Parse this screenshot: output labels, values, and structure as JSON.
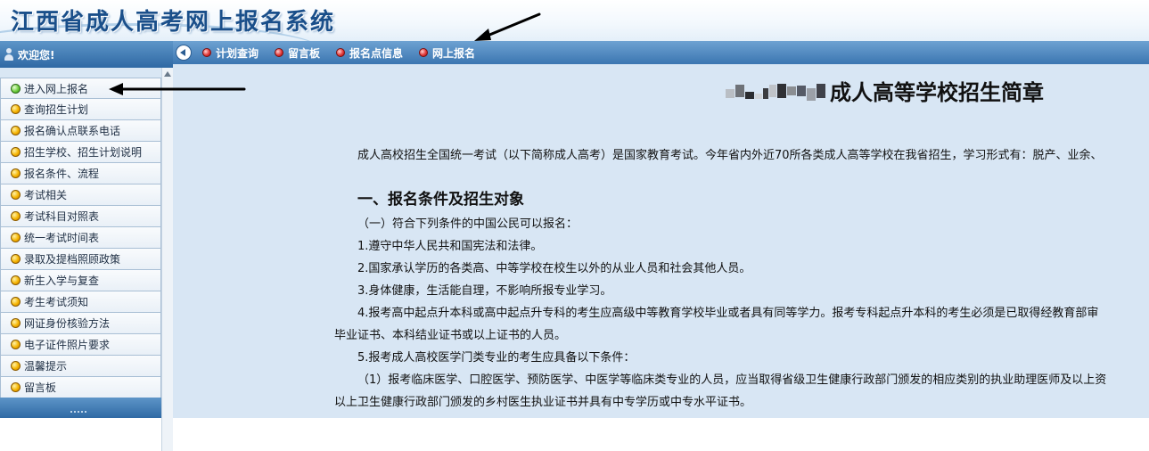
{
  "banner": {
    "title": "江西省成人高考网上报名系统"
  },
  "sidebar": {
    "welcome": "欢迎您!",
    "items": [
      {
        "label": "进入网上报名",
        "active": true
      },
      {
        "label": "查询招生计划"
      },
      {
        "label": "报名确认点联系电话"
      },
      {
        "label": "招生学校、招生计划说明"
      },
      {
        "label": "报名条件、流程"
      },
      {
        "label": "考试相关"
      },
      {
        "label": "考试科目对照表"
      },
      {
        "label": "统一考试时间表"
      },
      {
        "label": "录取及提档照顾政策"
      },
      {
        "label": "新生入学与复查"
      },
      {
        "label": "考生考试须知"
      },
      {
        "label": "网证身份核验方法"
      },
      {
        "label": "电子证件照片要求"
      },
      {
        "label": "温馨提示"
      },
      {
        "label": "留言板"
      }
    ]
  },
  "topnav": {
    "items": [
      {
        "label": "计划查询"
      },
      {
        "label": "留言板"
      },
      {
        "label": "报名点信息"
      },
      {
        "label": "网上报名"
      }
    ]
  },
  "content": {
    "doc_title": "成人高等学校招生简章",
    "intro": "成人高校招生全国统一考试（以下简称成人高考）是国家教育考试。今年省内外近70所各类成人高等学校在我省招生，学习形式有：脱产、业余、",
    "section1_heading": "一、报名条件及招生对象",
    "lines": [
      "（一）符合下列条件的中国公民可以报名：",
      "1.遵守中华人民共和国宪法和法律。",
      "2.国家承认学历的各类高、中等学校在校生以外的从业人员和社会其他人员。",
      "3.身体健康，生活能自理，不影响所报专业学习。",
      "4.报考高中起点升本科或高中起点升专科的考生应高级中等教育学校毕业或者具有同等学力。报考专科起点升本科的考生必须是已取得经教育部审",
      "毕业证书、本科结业证书或以上证书的人员。",
      "5.报考成人高校医学门类专业的考生应具备以下条件：",
      "（1）报考临床医学、口腔医学、预防医学、中医学等临床类专业的人员，应当取得省级卫生健康行政部门颁发的相应类别的执业助理医师及以上资",
      "以上卫生健康行政部门颁发的乡村医生执业证书并具有中专学历或中专水平证书。"
    ]
  },
  "colors": {
    "nav_blue": "#3b76b1",
    "content_bg": "#d8e6f4",
    "banner_title": "#1a4f8a",
    "arrow": "#000000"
  }
}
